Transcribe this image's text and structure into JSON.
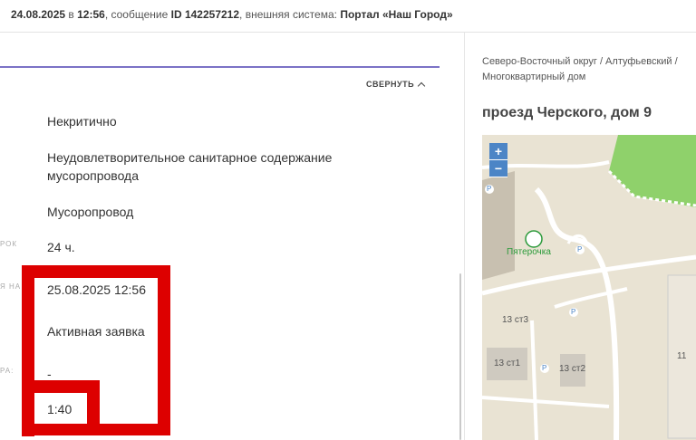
{
  "header": {
    "date": "24.08.2025",
    "in_word": "в",
    "time": "12:56",
    "message_word": ", сообщение",
    "id_label": "ID 142257212",
    "system_word": ", внешняя система:",
    "system_name": "Портал «Наш Город»"
  },
  "panel": {
    "collapse_label": "СВЕРНУТЬ",
    "rows": [
      {
        "label": "",
        "value": "Некритично"
      },
      {
        "label": "",
        "value": "Неудовлетворительное санитарное содержание"
      },
      {
        "label": "",
        "value": "мусоропровода"
      },
      {
        "label": "",
        "value": "Мусоропровод"
      },
      {
        "label": "РОК",
        "value": "24 ч."
      },
      {
        "label": "Я НА",
        "value": "25.08.2025 12:56"
      },
      {
        "label": "",
        "value": "Активная заявка"
      },
      {
        "label": "РА:",
        "value": "-"
      },
      {
        "label": "",
        "value": "1:40"
      }
    ]
  },
  "location": {
    "breadcrumb_line1": "Северо-Восточный округ / Алтуфьевский /",
    "breadcrumb_line2": "Многоквартирный дом",
    "address": "проезд Черского, дом 9"
  },
  "map": {
    "zoom_in": "+",
    "zoom_out": "−",
    "poi_name": "Пятерочка",
    "buildings": [
      "13 ст3",
      "13 ст1",
      "13 ст2",
      "11"
    ],
    "parking": "P",
    "colors": {
      "background": "#e9e3d3",
      "park": "#8fd16b",
      "road": "#ffffff",
      "building": "#cfcac0",
      "accent": "#4c85c6",
      "poi": "#2b9a3a"
    }
  },
  "annotation_color": "#dd0000"
}
